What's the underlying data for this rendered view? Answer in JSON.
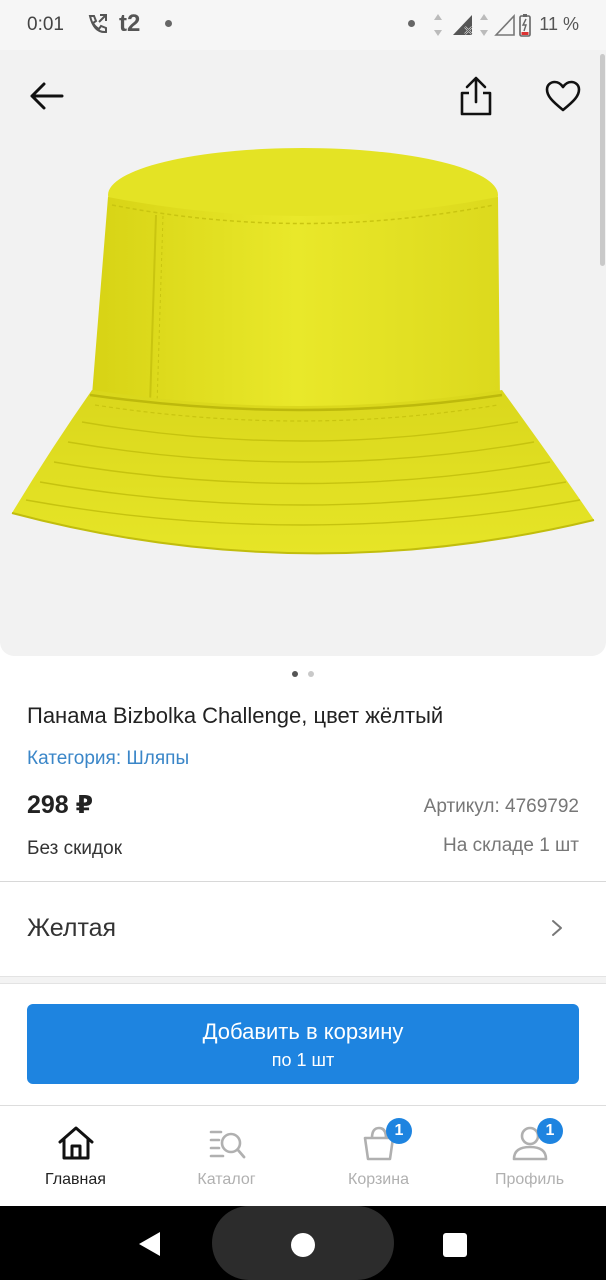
{
  "status_bar": {
    "time": "0:01",
    "carrier": "t2",
    "battery": "11 %"
  },
  "product": {
    "title": "Панама Bizbolka Challenge, цвет жёлтый",
    "category": "Категория: Шляпы",
    "price": "298 ₽",
    "article": "Артикул: 4769792",
    "discount": "Без скидок",
    "stock": "На складе 1 шт",
    "image": {
      "total": 2,
      "current": 1,
      "color": "#e3e321"
    }
  },
  "variant": {
    "label": "Желтая"
  },
  "add_to_cart": {
    "label": "Добавить в корзину",
    "sublabel": "по 1 шт"
  },
  "tabs": [
    {
      "label": "Главная",
      "icon": "home-icon",
      "active": true
    },
    {
      "label": "Каталог",
      "icon": "catalog-search-icon",
      "active": false
    },
    {
      "label": "Корзина",
      "icon": "cart-bag-icon",
      "active": false,
      "badge": "1"
    },
    {
      "label": "Профиль",
      "icon": "profile-icon",
      "active": false,
      "badge": "1"
    }
  ],
  "colors": {
    "accent": "#1e84e0",
    "link": "#3a86c8"
  }
}
